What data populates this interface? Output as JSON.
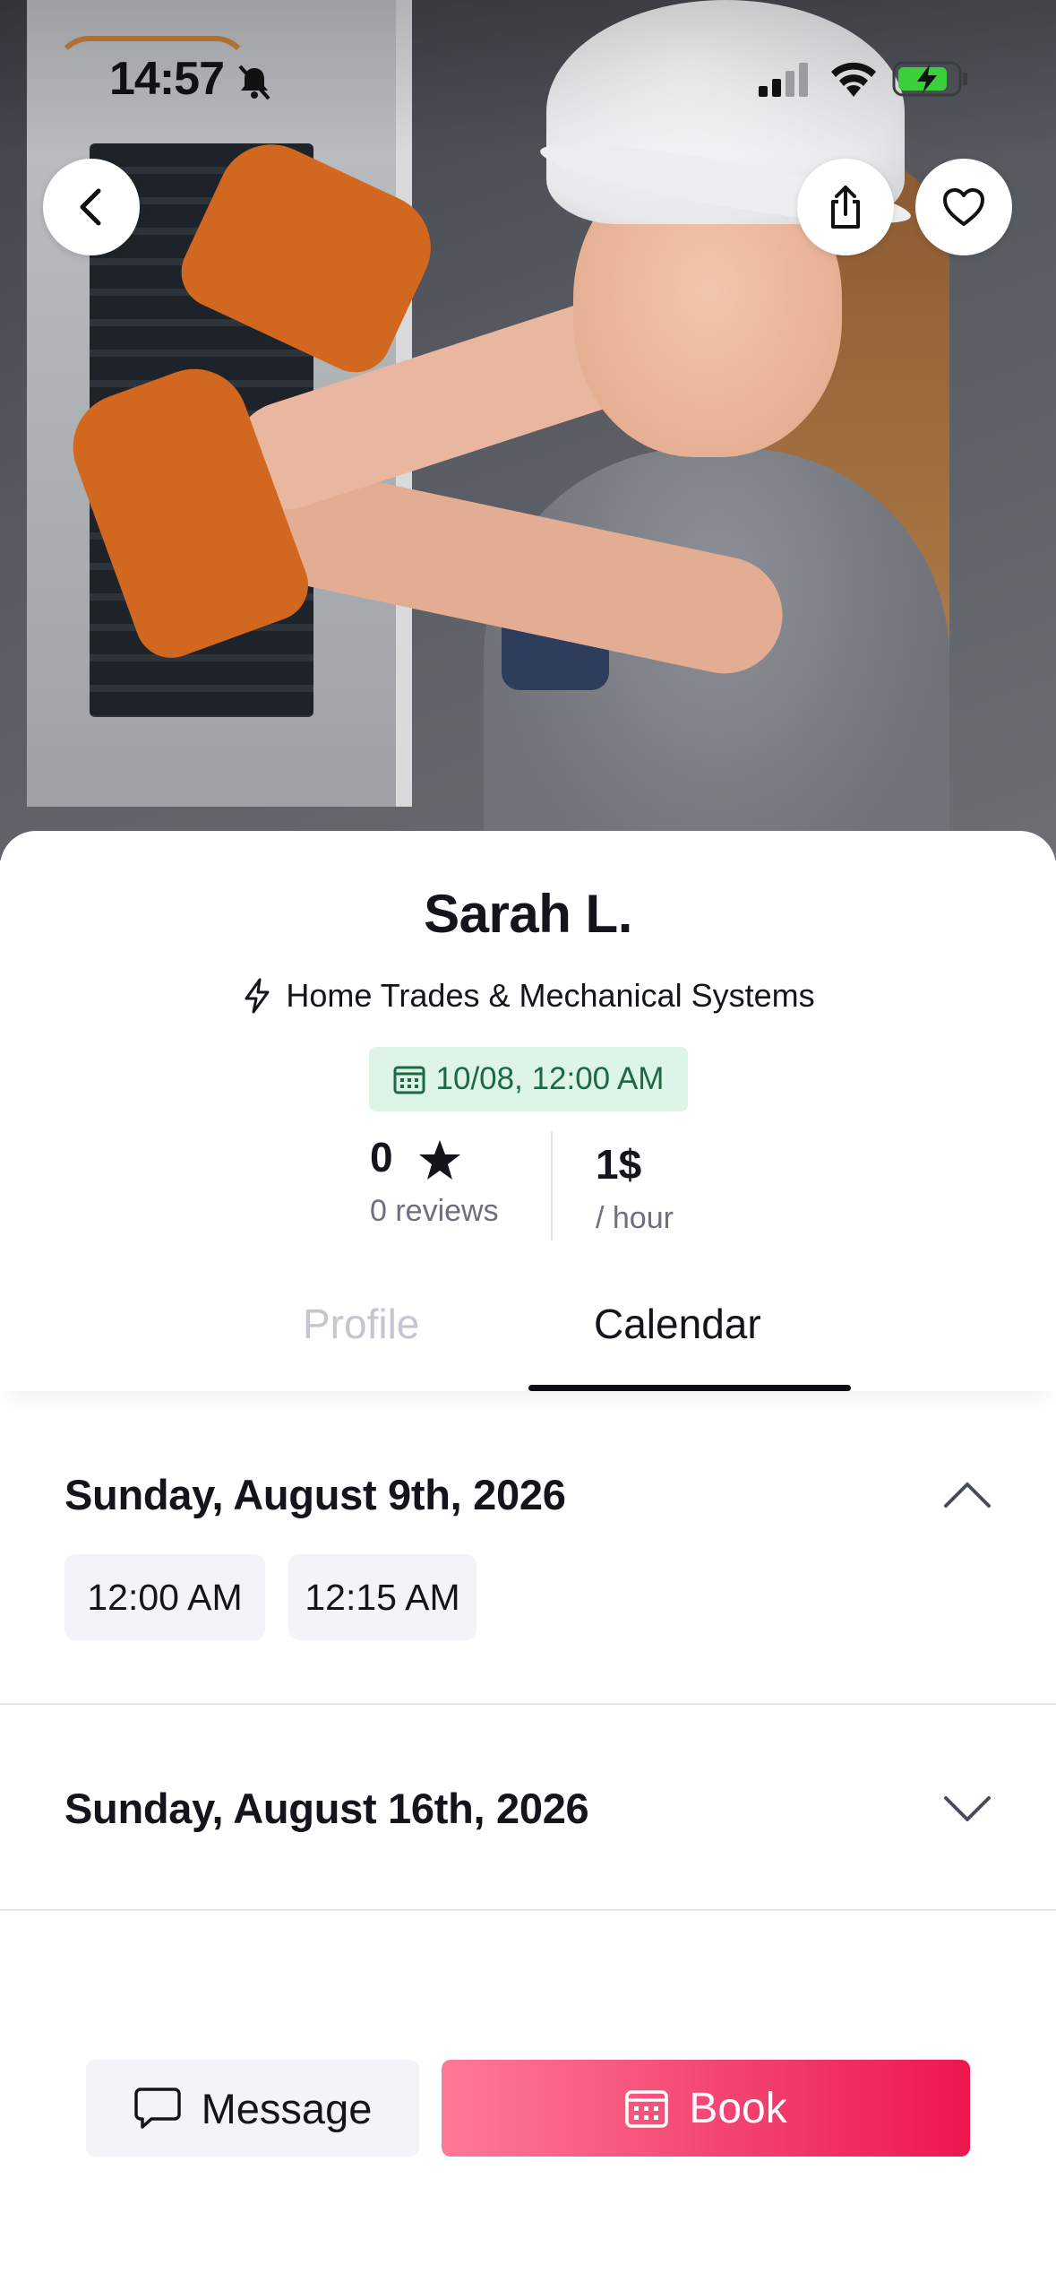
{
  "status_bar": {
    "time": "14:57"
  },
  "provider": {
    "name": "Sarah L.",
    "category": "Home Trades & Mechanical Systems",
    "next_available": "10/08, 12:00 AM",
    "rating": "0",
    "reviews": "0 reviews",
    "price": "1$",
    "price_unit": "/ hour"
  },
  "tabs": [
    {
      "label": "Profile",
      "active": false
    },
    {
      "label": "Calendar",
      "active": true
    }
  ],
  "calendar": {
    "days": [
      {
        "title": "Sunday, August 9th, 2026",
        "expanded": true,
        "slots": [
          "12:00 AM",
          "12:15 AM"
        ]
      },
      {
        "title": "Sunday, August 16th, 2026",
        "expanded": false,
        "slots": []
      }
    ]
  },
  "actions": {
    "message_label": "Message",
    "book_label": "Book"
  },
  "icons": {
    "back": "chevron-left-icon",
    "share": "share-icon",
    "favorite": "heart-icon",
    "category": "lightning-bolt-icon",
    "date": "calendar-icon",
    "rating": "star-icon",
    "message": "chat-bubble-icon",
    "book": "calendar-icon"
  },
  "colors": {
    "accent_start": "#ff7a96",
    "accent_end": "#ee1650",
    "chip_bg": "#dcf5e6",
    "chip_text": "#1c6a44",
    "battery_green": "#3ccf3c"
  }
}
